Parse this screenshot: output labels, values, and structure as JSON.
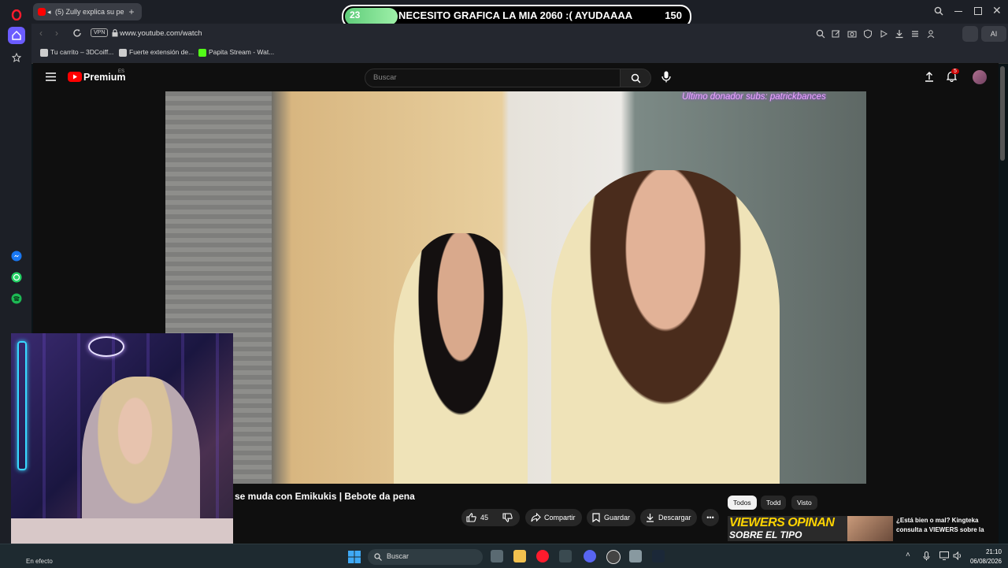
{
  "browser": {
    "active_tab_title": "(5) Zully explica su pe",
    "url": "www.youtube.com/watch",
    "vpn_label": "VPN",
    "ai_label": "AI",
    "bookmarks": [
      {
        "label": "Tu carrito – 3DCoiff..."
      },
      {
        "label": "Fuerte extensión de..."
      },
      {
        "label": "Papita Stream - Wat..."
      }
    ]
  },
  "stream_goal": {
    "current": "23",
    "text": "NECESITO GRAFICA LA MIA 2060 :( AYUDAAAA",
    "target": "150",
    "progress_fraction": 0.153
  },
  "youtube": {
    "logo_text": "Premium",
    "region": "ES",
    "search_placeholder": "Buscar",
    "notification_count": "5",
    "overlay_donor": "Último donador subs: patrickbances",
    "video_title": "ng se muda con Emikukis | Bebote da pena",
    "likes": "45",
    "share_label": "Compartir",
    "save_label": "Guardar",
    "download_label": "Descargar",
    "chips": [
      "Todos",
      "Todd",
      "Visto"
    ],
    "suggested": {
      "thumb_text_1": "VIEWERS OPINAN",
      "thumb_text_2": "SOBRE EL TIPO",
      "title_line1": "¿Está bien o mal? Kingteka",
      "title_line2": "consulta a VIEWERS sobre la"
    }
  },
  "taskbar": {
    "status": "En efecto",
    "search_placeholder": "Buscar",
    "time": "21:10",
    "date": "06/08/2026"
  },
  "colors": {
    "goal_fill": "#7ddf8e",
    "youtube_red": "#ff0000",
    "opera_red": "#ff1b2d"
  }
}
